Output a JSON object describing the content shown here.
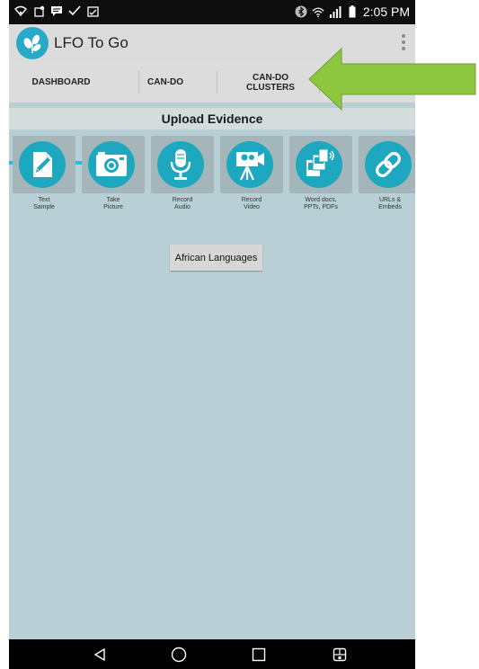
{
  "status_bar": {
    "time": "2:05 PM",
    "icons": [
      "wifi-icon",
      "notification-icon",
      "message-icon",
      "check-icon",
      "clipboard-icon",
      "bluetooth-icon",
      "signal-icon",
      "battery-icon"
    ]
  },
  "app_bar": {
    "title": "LFO To Go",
    "logo": "lfo-logo",
    "overflow_icon": "more-vert-icon"
  },
  "tabs": [
    {
      "label": "DASHBOARD",
      "active": true
    },
    {
      "label": "CAN-DO",
      "active": false
    },
    {
      "label_line1": "CAN-DO",
      "label_line2": "CLUSTERS",
      "active": false
    }
  ],
  "section": {
    "title": "Upload Evidence"
  },
  "upload_items": [
    {
      "line1": "Text",
      "line2": "Sample",
      "icon": "document-edit-icon"
    },
    {
      "line1": "Take",
      "line2": "Picture",
      "icon": "camera-icon"
    },
    {
      "line1": "Record",
      "line2": "Audio",
      "icon": "microphone-icon"
    },
    {
      "line1": "Record",
      "line2": "Video",
      "icon": "video-camera-icon"
    },
    {
      "line1": "Word docs,",
      "line2": "PPTs, PDFs",
      "icon": "media-files-icon"
    },
    {
      "line1": "URLs &",
      "line2": "Embeds",
      "icon": "link-icon"
    }
  ],
  "language_button": "African Languages",
  "nav_bar": {
    "icons": [
      "back-icon",
      "home-icon",
      "recents-icon",
      "qslide-icon"
    ]
  },
  "colors": {
    "accent": "#33b5e5",
    "icon_circle": "#1ea8bf",
    "background": "#b8cfd5",
    "arrow": "#8dc63f"
  }
}
